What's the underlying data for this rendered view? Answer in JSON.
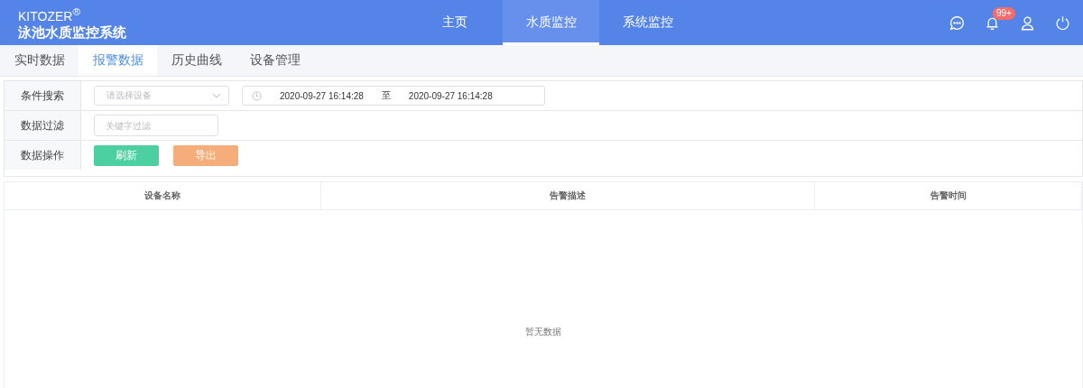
{
  "brand": {
    "name": "KITOZER$^{®}$",
    "title": "泳池水质监控系统"
  },
  "nav": [
    {
      "label": "主页",
      "selected": false
    },
    {
      "label": "水质监控",
      "selected": true
    },
    {
      "label": "系统监控",
      "selected": false
    }
  ],
  "notifications": {
    "badge": "99+"
  },
  "tabs": [
    {
      "label": "实时数据",
      "selected": false
    },
    {
      "label": "报警数据",
      "selected": true
    },
    {
      "label": "历史曲线",
      "selected": false
    },
    {
      "label": "设备管理",
      "selected": false
    }
  ],
  "filters": {
    "search_label": "条件搜索",
    "device_placeholder": "请选择设备",
    "start_time": "2020-09-27 16:14:28",
    "range_separator": "至",
    "end_time": "2020-09-27 16:14:28",
    "filter_label": "数据过滤",
    "keyword_placeholder": "关键字过滤",
    "actions_label": "数据操作",
    "buttons": [
      {
        "label": "刷新",
        "kind": "refresh"
      },
      {
        "label": "导出",
        "kind": "export"
      }
    ]
  },
  "table": {
    "columns": [
      "设备名称",
      "告警描述",
      "告警时间"
    ],
    "empty_text": "暂无数据"
  }
}
